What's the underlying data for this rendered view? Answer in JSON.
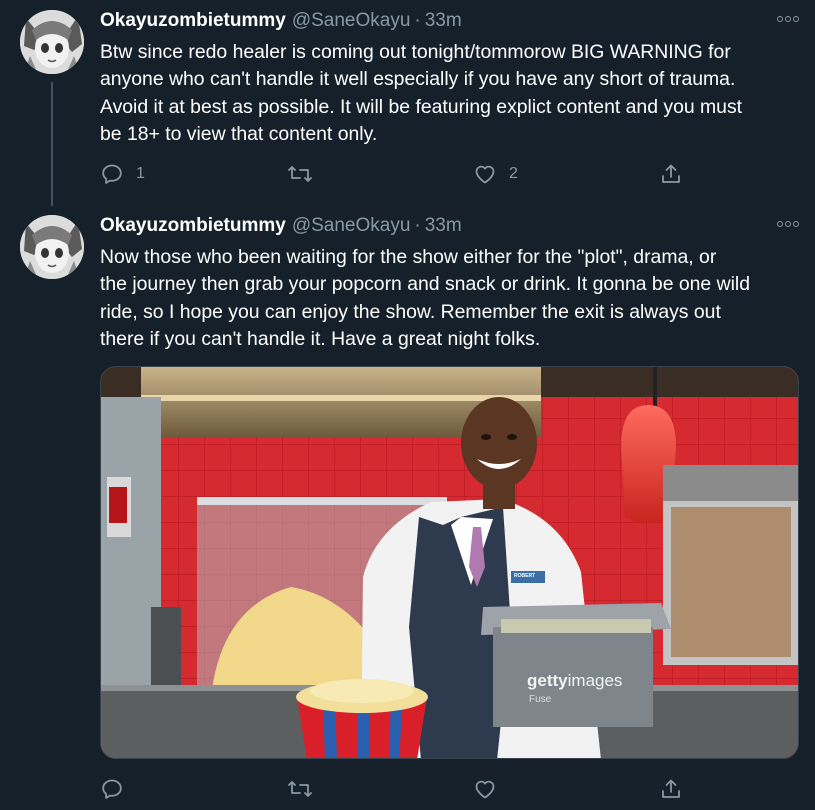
{
  "tweets": [
    {
      "name": "Okayuzombietummy",
      "handle": "@SaneOkayu",
      "separator": "·",
      "time": "33m",
      "text": "Btw since redo healer is coming out tonight/tommorow BIG WARNING for\nanyone who can't handle it well especially if you have any short of trauma.\nAvoid it at best as possible. It will be featuring explict content and you must\nbe 18+ to view that content only.",
      "reply_count": "1",
      "retweet_count": "",
      "like_count": "2"
    },
    {
      "name": "Okayuzombietummy",
      "handle": "@SaneOkayu",
      "separator": "·",
      "time": "33m",
      "text": "Now those who been waiting for the show either for the \"plot\", drama, or\nthe journey then grab your popcorn and snack or drink. It gonna be one wild\nride, so I hope you can enjoy the show. Remember the exit is always out\nthere if you can't handle it. Have a great night folks.",
      "reply_count": "",
      "retweet_count": "",
      "like_count": "",
      "media": {
        "watermark_a": "getty",
        "watermark_b": "images",
        "watermark_credit": "Fuse",
        "badge_text": "ROBERT"
      }
    }
  ],
  "colors": {
    "background": "#15202b",
    "secondary_text": "#8899a6",
    "thread_line": "#3d5466"
  },
  "icons": [
    "reply-icon",
    "retweet-icon",
    "like-icon",
    "share-icon",
    "more-icon"
  ]
}
